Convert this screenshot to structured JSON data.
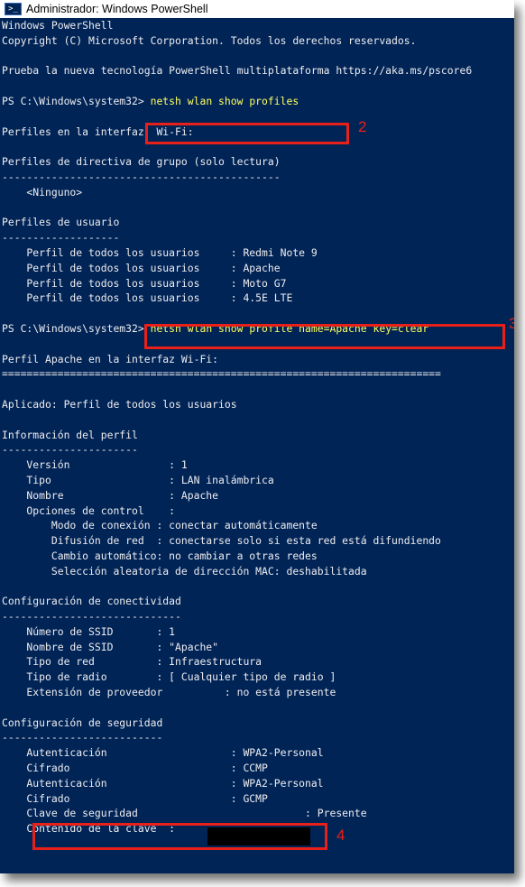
{
  "window": {
    "title": "Administrador: Windows PowerShell"
  },
  "console": {
    "header": [
      "Windows PowerShell",
      "Copyright (C) Microsoft Corporation. Todos los derechos reservados.",
      "",
      "Prueba la nueva tecnología PowerShell multiplataforma https://aka.ms/pscore6",
      ""
    ],
    "prompt": "PS C:\\Windows\\system32> ",
    "cmd1": "netsh wlan show profiles",
    "block1": [
      "",
      "Perfiles en la interfaz  Wi-Fi:",
      "",
      "Perfiles de directiva de grupo (solo lectura)",
      "---------------------------------------------",
      "    <Ninguno>",
      "",
      "Perfiles de usuario",
      "-------------------",
      "    Perfil de todos los usuarios     : Redmi Note 9",
      "    Perfil de todos los usuarios     : Apache",
      "    Perfil de todos los usuarios     : Moto G7",
      "    Perfil de todos los usuarios     : 4.5E LTE",
      ""
    ],
    "cmd2": "netsh wlan show profile name=Apache key=clear",
    "block2": [
      "",
      "Perfil Apache en la interfaz Wi-Fi:",
      "=======================================================================",
      "",
      "Aplicado: Perfil de todos los usuarios",
      "",
      "Información del perfil",
      "----------------------",
      "    Versión                : 1",
      "    Tipo                   : LAN inalámbrica",
      "    Nombre                 : Apache",
      "    Opciones de control    :",
      "        Modo de conexión : conectar automáticamente",
      "        Difusión de red  : conectarse solo si esta red está difundiendo",
      "        Cambio automático: no cambiar a otras redes",
      "        Selección aleatoria de dirección MAC: deshabilitada",
      "",
      "Configuración de conectividad",
      "-----------------------------",
      "    Número de SSID       : 1",
      "    Nombre de SSID       : \"Apache\"",
      "    Tipo de red          : Infraestructura",
      "    Tipo de radio        : [ Cualquier tipo de radio ]",
      "    Extensión de proveedor          : no está presente",
      "",
      "Configuración de seguridad",
      "--------------------------",
      "    Autenticación                    : WPA2-Personal",
      "    Cifrado                          : CCMP",
      "    Autenticación                    : WPA2-Personal",
      "    Cifrado                          : GCMP",
      "    Clave de seguridad                           : Presente",
      "    Contenido de la clave  : "
    ]
  },
  "callouts": {
    "n2": "2",
    "n3": "3",
    "n4": "4"
  },
  "colors": {
    "background": "#012456",
    "text": "#eeedf0",
    "command": "#ffff60",
    "callout": "#e8201a"
  }
}
